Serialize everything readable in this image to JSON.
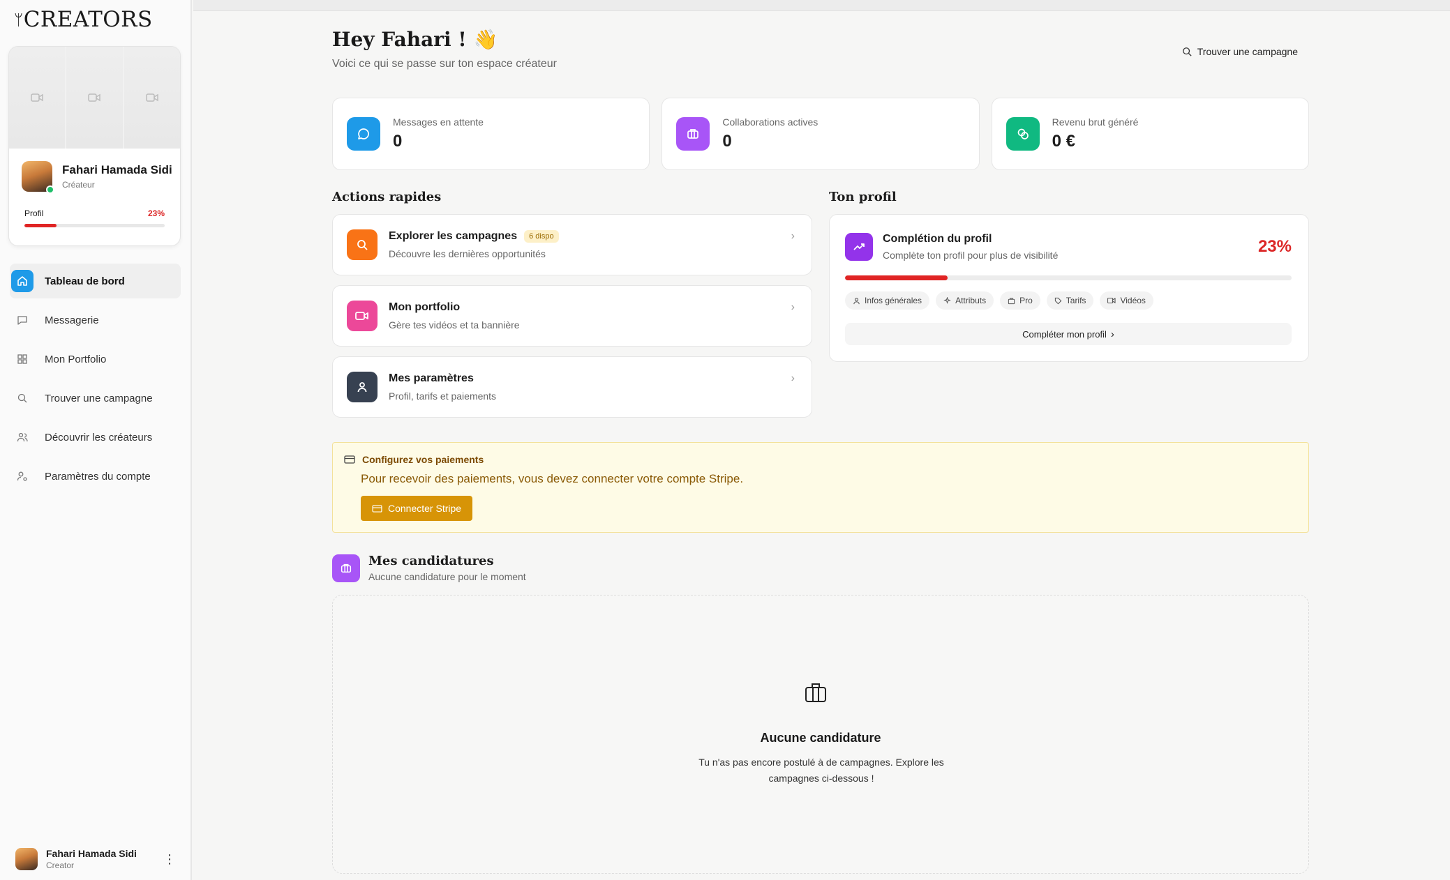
{
  "brand": "CREATORS",
  "profile_card": {
    "name": "Fahari Hamada Sidi",
    "role": "Créateur",
    "progress_label": "Profil",
    "progress_pct_text": "23%",
    "progress_value": 0.23
  },
  "nav": [
    {
      "label": "Tableau de bord",
      "icon": "home-icon",
      "active": true
    },
    {
      "label": "Messagerie",
      "icon": "message-icon",
      "active": false
    },
    {
      "label": "Mon Portfolio",
      "icon": "grid-icon",
      "active": false
    },
    {
      "label": "Trouver une campagne",
      "icon": "search-icon",
      "active": false
    },
    {
      "label": "Découvrir les créateurs",
      "icon": "users-icon",
      "active": false
    },
    {
      "label": "Paramètres du compte",
      "icon": "user-settings-icon",
      "active": false
    }
  ],
  "sidebar_user": {
    "name": "Fahari Hamada Sidi",
    "role": "Creator"
  },
  "header": {
    "title": "Hey Fahari ! 👋",
    "subtitle": "Voici ce qui se passe sur ton espace créateur",
    "find_campaign": "Trouver une campagne"
  },
  "stats": [
    {
      "label": "Messages en attente",
      "value": "0",
      "color": "#1e9ae8",
      "icon": "chat-icon"
    },
    {
      "label": "Collaborations actives",
      "value": "0",
      "color": "#a855f7",
      "icon": "briefcase-icon"
    },
    {
      "label": "Revenu brut généré",
      "value": "0 €",
      "color": "#10b981",
      "icon": "coins-icon"
    }
  ],
  "quick_actions": {
    "title": "Actions rapides",
    "items": [
      {
        "title": "Explorer les campagnes",
        "badge": "6 dispo",
        "subtitle": "Découvre les dernières opportunités",
        "color": "#f97316",
        "icon": "search-icon"
      },
      {
        "title": "Mon portfolio",
        "badge": "",
        "subtitle": "Gère tes vidéos et ta bannière",
        "color": "#ec4899",
        "icon": "video-icon"
      },
      {
        "title": "Mes paramètres",
        "badge": "",
        "subtitle": "Profil, tarifs et paiements",
        "color": "#374151",
        "icon": "user-icon"
      }
    ]
  },
  "profile_section": {
    "title": "Ton profil",
    "card_title": "Complétion du profil",
    "card_subtitle": "Complète ton profil pour plus de visibilité",
    "pct_text": "23%",
    "progress_value": 0.23,
    "chips": [
      "Infos générales",
      "Attributs",
      "Pro",
      "Tarifs",
      "Vidéos"
    ],
    "button": "Compléter mon profil"
  },
  "stripe": {
    "title": "Configurez vos paiements",
    "text": "Pour recevoir des paiements, vous devez connecter votre compte Stripe.",
    "button": "Connecter Stripe"
  },
  "candidatures": {
    "title": "Mes candidatures",
    "subtitle": "Aucune candidature pour le moment",
    "empty_title": "Aucune candidature",
    "empty_text": "Tu n'as pas encore postulé à de campagnes. Explore les campagnes ci-dessous !"
  },
  "colors": {
    "accent": "#1e9ae8",
    "danger": "#dc2626",
    "stripe": "#d79407"
  }
}
